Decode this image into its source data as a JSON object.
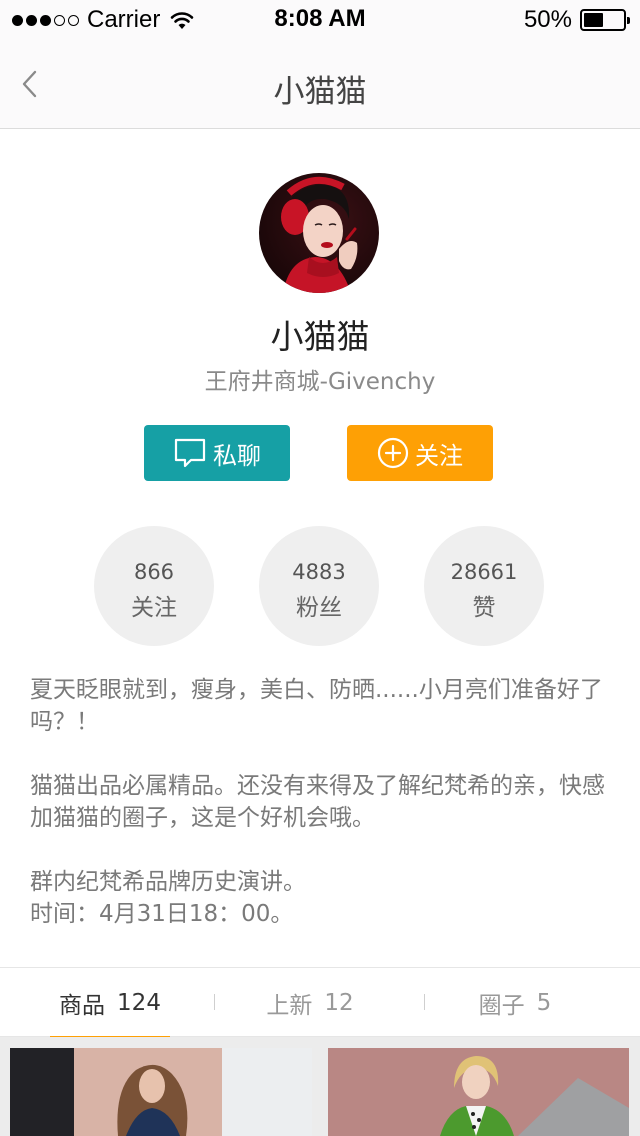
{
  "status_bar": {
    "carrier": "Carrier",
    "time": "8:08 AM",
    "battery": "50%",
    "battery_level": 0.5,
    "signal_bars": 3
  },
  "nav": {
    "title": "小猫猫"
  },
  "profile": {
    "name": "小猫猫",
    "subtitle": "王府井商城-Givenchy",
    "chat_label": "私聊",
    "follow_label": "关注"
  },
  "stats": [
    {
      "value": "866",
      "label": "关注"
    },
    {
      "value": "4883",
      "label": "粉丝"
    },
    {
      "value": "28661",
      "label": "赞"
    }
  ],
  "bio": {
    "p1": "夏天眨眼就到，瘦身，美白、防晒......小月亮们准备好了吗？！",
    "p2": "猫猫出品必属精品。还没有来得及了解纪梵希的亲，快感加猫猫的圈子，这是个好机会哦。",
    "p3a": "群内纪梵希品牌历史演讲。",
    "p3b": "时间：4月31日18：00。"
  },
  "tabs": [
    {
      "label": "商品",
      "count": "124"
    },
    {
      "label": "上新",
      "count": "12"
    },
    {
      "label": "圈子",
      "count": "5"
    }
  ],
  "colors": {
    "chat_button": "#16a0a5",
    "follow_button": "#fea005",
    "active_tab_underline": "#fea005"
  }
}
